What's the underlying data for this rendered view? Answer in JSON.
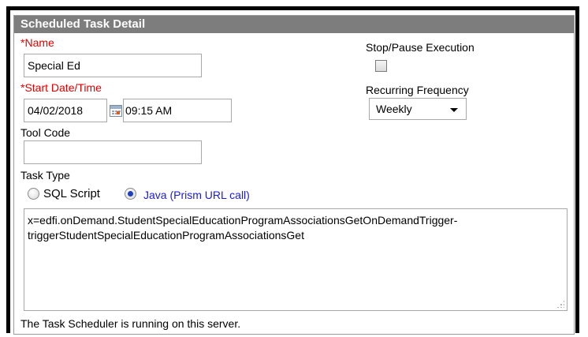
{
  "panel": {
    "title": "Scheduled Task Detail"
  },
  "name": {
    "asterisk": "*",
    "label": "Name",
    "value": "Special Ed"
  },
  "start": {
    "asterisk": "*",
    "label": "Start Date/Time",
    "date": "04/02/2018",
    "time": "09:15 AM",
    "calendar_icon": "calendar-icon"
  },
  "tool_code": {
    "label": "Tool Code",
    "value": ""
  },
  "stop_pause": {
    "label": "Stop/Pause Execution",
    "checked": false
  },
  "recurring": {
    "label": "Recurring Frequency",
    "selected": "Weekly"
  },
  "task_type": {
    "label": "Task Type",
    "options": [
      {
        "label": "SQL Script",
        "selected": false,
        "color": "#000000"
      },
      {
        "label": "Java (Prism URL call)",
        "selected": true,
        "color": "#1a1ae6"
      }
    ],
    "content": "x=edfi.onDemand.StudentSpecialEducationProgramAssociationsGetOnDemandTrigger-triggerStudentSpecialEducationProgramAssociationsGet"
  },
  "status_text": "The Task Scheduler is running on this server.",
  "colors": {
    "header_bg": "#7d7d7d",
    "required": "#e00000",
    "link_blue": "#1a1ae6"
  }
}
